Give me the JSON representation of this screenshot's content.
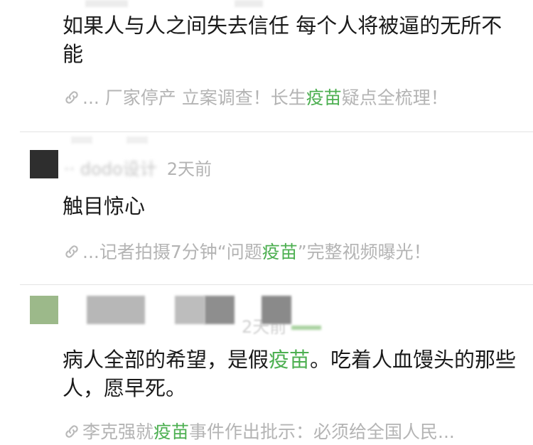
{
  "comments": [
    {
      "author": "",
      "time": "",
      "content": "如果人与人之间失去信任 每个人将被逼的无所不能",
      "link": {
        "before": "... 厂家停产 立案调查！长生",
        "keyword": "疫苗",
        "after": "疑点全梳理！"
      }
    },
    {
      "author": "·· dodo设计",
      "time": "2天前",
      "content": "触目惊心",
      "link": {
        "before": "...记者拍摄7分钟“问题",
        "keyword": "疫苗",
        "after": "”完整视频曝光！"
      }
    },
    {
      "author": "",
      "time": "2天前",
      "content_before": "病人全部的希望，是假",
      "content_keyword": "疫苗",
      "content_after": "。吃着人血馒头的那些人，愿早死。",
      "link": {
        "before": "李克强就",
        "keyword": "疫苗",
        "after": "事件作出批示：必须给全国人民..."
      }
    }
  ],
  "colors": {
    "keyword": "#4caf50",
    "secondary_text": "#b4b4b4",
    "avatar2": "#2e2e2e",
    "avatar3": "#9cb98a"
  },
  "icons": {
    "link": "link-chain-icon"
  }
}
